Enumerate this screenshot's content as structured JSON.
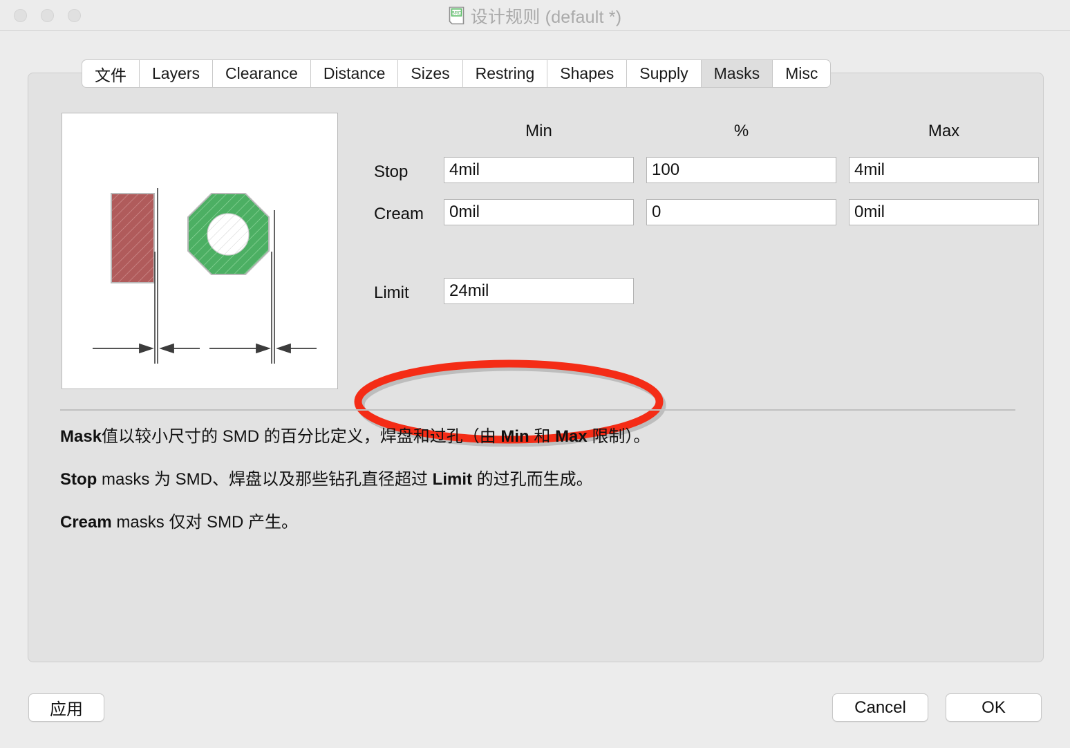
{
  "window": {
    "title": "设计规则 (default *)",
    "icon": "document-icon",
    "traffic_lights": [
      "close",
      "minimize",
      "zoom"
    ]
  },
  "tabs": [
    {
      "label": "文件",
      "selected": false
    },
    {
      "label": "Layers",
      "selected": false
    },
    {
      "label": "Clearance",
      "selected": false
    },
    {
      "label": "Distance",
      "selected": false
    },
    {
      "label": "Sizes",
      "selected": false
    },
    {
      "label": "Restring",
      "selected": false
    },
    {
      "label": "Shapes",
      "selected": false
    },
    {
      "label": "Supply",
      "selected": false
    },
    {
      "label": "Masks",
      "selected": true
    },
    {
      "label": "Misc",
      "selected": false
    }
  ],
  "form": {
    "columns": {
      "min": "Min",
      "percent": "%",
      "max": "Max"
    },
    "rows": [
      {
        "label": "Stop",
        "min": "4mil",
        "percent": "100",
        "max": "4mil"
      },
      {
        "label": "Cream",
        "min": "0mil",
        "percent": "0",
        "max": "0mil"
      }
    ],
    "limit": {
      "label": "Limit",
      "value": "24mil"
    }
  },
  "annotation": {
    "shape": "ellipse",
    "color": "#f42c16",
    "target": "limit-field"
  },
  "diagram": {
    "name": "mask-illustration",
    "smd_color": "#b05b5b",
    "pad_color": "#4caf63",
    "drill_color": "#ffffff"
  },
  "description": {
    "line1": {
      "b1": "Mask",
      "t1": "值以较小尺寸的 SMD 的百分比定义，焊盘和过孔（由 ",
      "b2": "Min",
      "t2": " 和 ",
      "b3": "Max",
      "t3": " 限制）。"
    },
    "line2": {
      "b1": "Stop",
      "t1": " masks 为 SMD、焊盘以及那些钻孔直径超过 ",
      "b2": "Limit",
      "t2": " 的过孔而生成。"
    },
    "line3": {
      "b1": "Cream",
      "t1": " masks 仅对 SMD 产生。"
    }
  },
  "buttons": {
    "apply": "应用",
    "cancel": "Cancel",
    "ok": "OK"
  }
}
